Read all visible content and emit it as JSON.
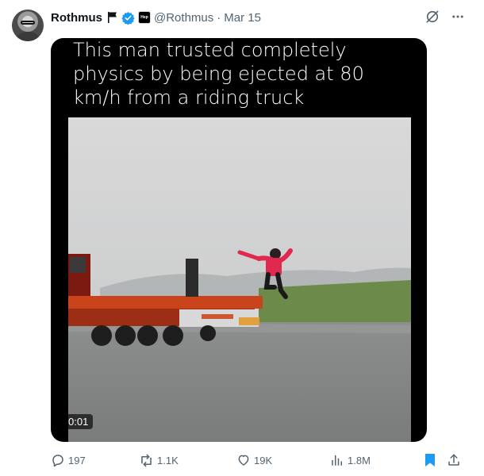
{
  "tweet": {
    "author_name": "Rothmus",
    "handle": "@Rothmus",
    "separator": "·",
    "date": "Mar 15",
    "affiliate_badge_text": "Hep",
    "caption": "This man trusted completely physics by being ejected at 80 km/h from a riding truck",
    "video_time": "0:01"
  },
  "metrics": {
    "replies": "197",
    "reposts": "1.1K",
    "likes": "19K",
    "views": "1.8M"
  },
  "icons": {
    "flag": "flag-icon",
    "verified": "verified-badge-icon",
    "grok": "grok-icon",
    "more": "more-icon",
    "reply": "reply-icon",
    "repost": "repost-icon",
    "like": "like-icon",
    "views": "views-icon",
    "bookmark": "bookmark-icon",
    "share": "share-icon"
  },
  "colors": {
    "accent": "#1d9bf0",
    "text": "#0f1419",
    "secondary": "#536471",
    "bookmark_active": "#1d9bf0",
    "jacket": "#e0294e",
    "truck": "#d94a1c"
  }
}
